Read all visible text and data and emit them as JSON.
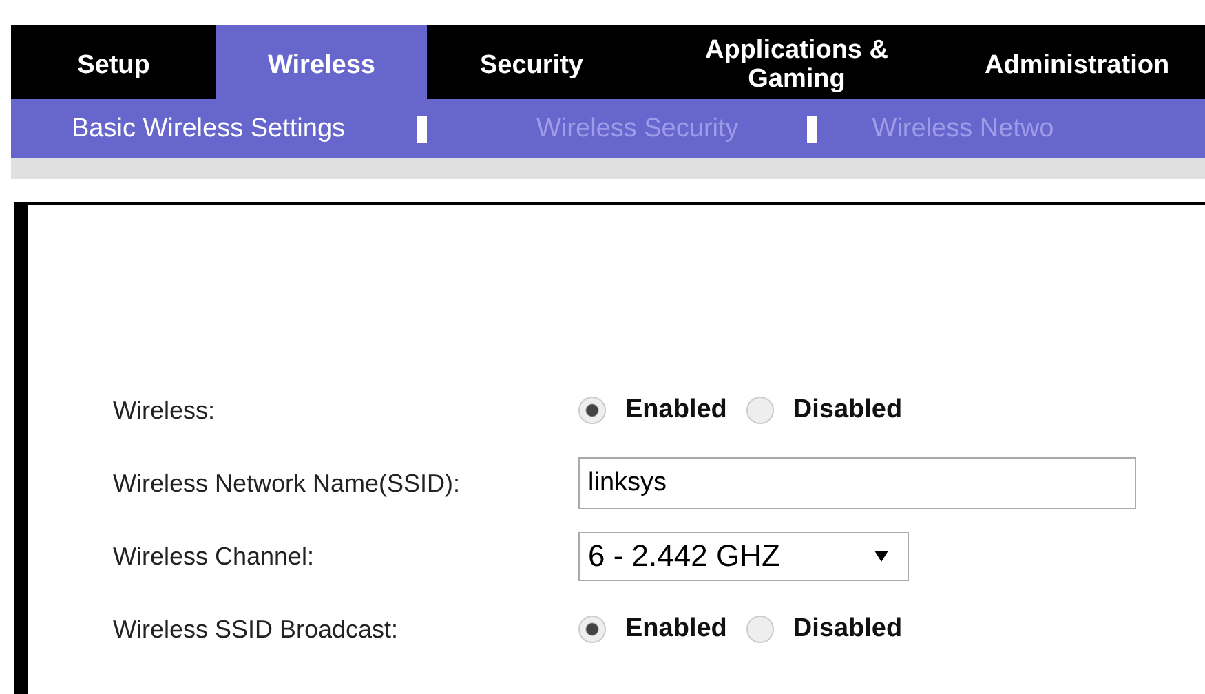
{
  "tabs": [
    {
      "label": "Setup",
      "selected": false
    },
    {
      "label": "Wireless",
      "selected": true
    },
    {
      "label": "Security",
      "selected": false
    },
    {
      "label": "Applications &\nGaming",
      "selected": false
    },
    {
      "label": "Administration",
      "selected": false
    }
  ],
  "subtabs": [
    {
      "label": "Basic Wireless Settings",
      "selected": true
    },
    {
      "label": "Wireless Security",
      "selected": false
    },
    {
      "label": "Wireless Netwo",
      "selected": false
    }
  ],
  "settings": [
    {
      "kind": "radio",
      "label": "Wireless:",
      "options": [
        {
          "label": "Enabled",
          "selected": true
        },
        {
          "label": "Disabled",
          "selected": false
        }
      ]
    },
    {
      "kind": "text",
      "label": "Wireless Network Name(SSID):",
      "value": "linksys"
    },
    {
      "kind": "select",
      "label": "Wireless Channel:",
      "value": "6 - 2.442 GHZ"
    },
    {
      "kind": "radio",
      "label": "Wireless SSID Broadcast:",
      "options": [
        {
          "label": "Enabled",
          "selected": true
        },
        {
          "label": "Disabled",
          "selected": false
        }
      ]
    }
  ]
}
